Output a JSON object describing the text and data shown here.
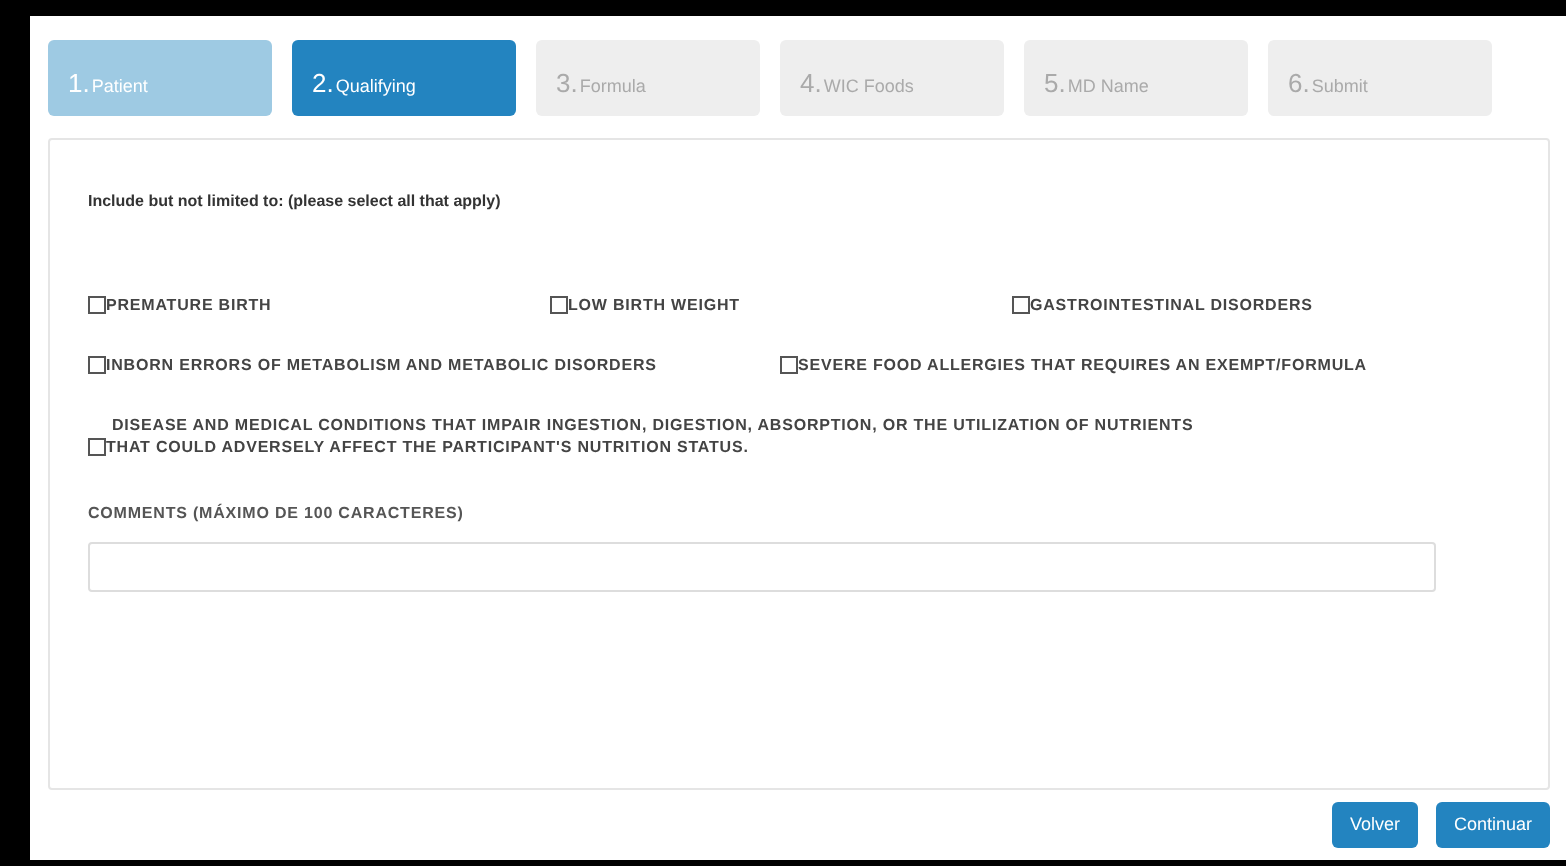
{
  "steps": [
    {
      "number": "1.",
      "label": "Patient",
      "completed": true,
      "selected": false
    },
    {
      "number": "2.",
      "label": "Qualifying",
      "completed": false,
      "selected": true
    },
    {
      "number": "3.",
      "label": "Formula",
      "completed": false,
      "selected": false
    },
    {
      "number": "4.",
      "label": "WIC Foods",
      "completed": false,
      "selected": false
    },
    {
      "number": "5.",
      "label": "MD Name",
      "completed": false,
      "selected": false
    },
    {
      "number": "6.",
      "label": "Submit",
      "completed": false,
      "selected": false
    }
  ],
  "instructions": "Include but not limited to: (please select all that apply)",
  "option_rows": [
    [
      {
        "lines": [
          "PREMATURE BIRTH"
        ],
        "checked": false
      },
      {
        "lines": [
          "LOW BIRTH WEIGHT"
        ],
        "checked": false
      },
      {
        "lines": [
          "GASTROINTESTINAL DISORDERS"
        ],
        "checked": false
      }
    ],
    [
      {
        "lines": [
          "INBORN ERRORS OF METABOLISM AND METABOLIC DISORDERS"
        ],
        "checked": false
      },
      {
        "lines": [
          "SEVERE FOOD ALLERGIES THAT REQUIRES AN EXEMPT/FORMULA"
        ],
        "checked": false
      }
    ],
    [
      {
        "lines": [
          "DISEASE AND MEDICAL CONDITIONS THAT IMPAIR INGESTION, DIGESTION, ABSORPTION, OR THE UTILIZATION OF NUTRIENTS",
          "THAT COULD ADVERSELY AFFECT THE PARTICIPANT'S NUTRITION STATUS."
        ],
        "checked": false
      }
    ]
  ],
  "comments": {
    "label": "COMMENTS (MÁXIMO DE 100 CARACTERES)"
  },
  "buttons": [
    "Volver",
    "Continuar"
  ]
}
